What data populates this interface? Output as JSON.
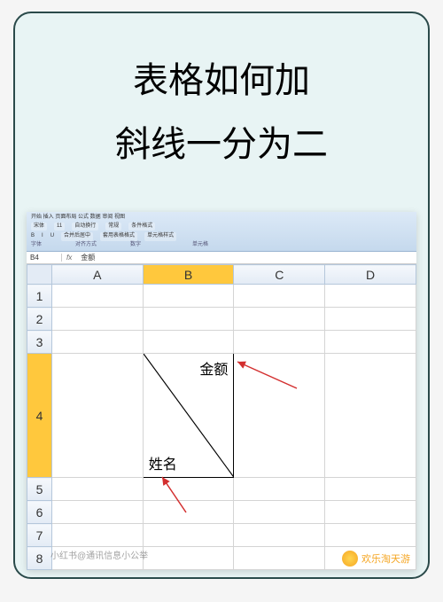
{
  "title": {
    "line1": "表格如何加",
    "line2": "斜线一分为二"
  },
  "ribbon": {
    "tabs": "开始 插入 页面布局 公式 数据 审阅 视图",
    "font_name": "宋体",
    "font_size": "11",
    "group_font": "字体",
    "group_align": "对齐方式",
    "group_number": "数字",
    "style_general": "常规",
    "wrap": "自动换行",
    "merge": "合并后居中",
    "cond_format": "条件格式",
    "cell_styles": "单元格样式",
    "format_table": "套用表格格式",
    "cells": "单元格"
  },
  "formula": {
    "cell_ref": "B4",
    "fx": "fx",
    "value": "金额"
  },
  "grid": {
    "cols": [
      "A",
      "B",
      "C",
      "D"
    ],
    "rows": [
      "1",
      "2",
      "3",
      "4",
      "5",
      "6",
      "7",
      "8"
    ],
    "diagonal": {
      "top_label": "金额",
      "bottom_label": "姓名"
    }
  },
  "watermarks": {
    "left": "小红书@通讯信息小公举",
    "right": "欢乐淘天游"
  }
}
